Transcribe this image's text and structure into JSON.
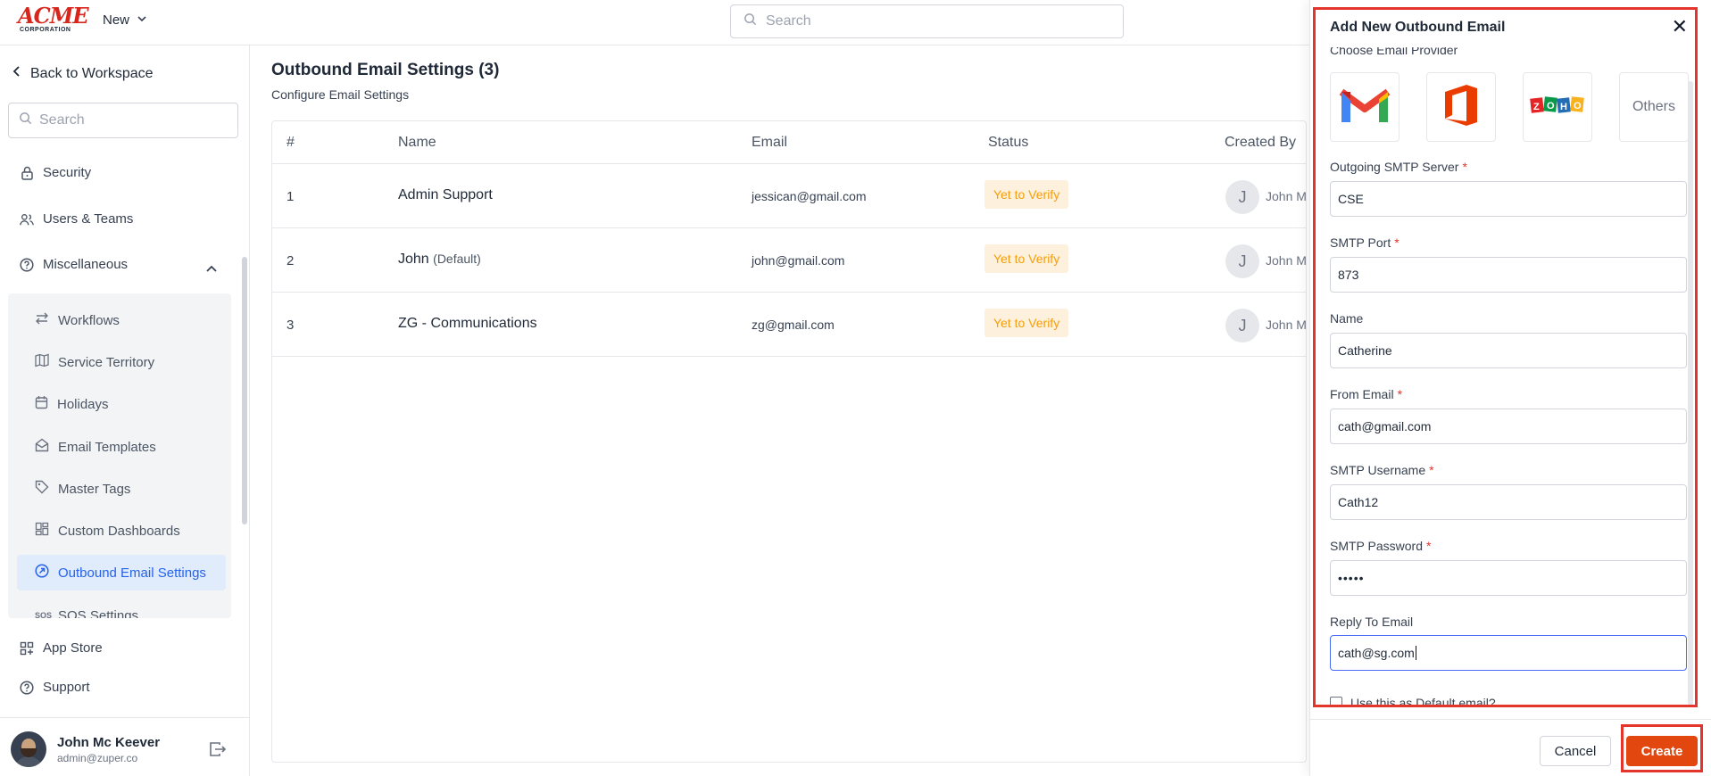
{
  "topbar": {
    "logo_main": "ACME",
    "logo_sub": "CORPORATION",
    "new_label": "New",
    "search_placeholder": "Search"
  },
  "sidebar": {
    "back_label": "Back to Workspace",
    "search_placeholder": "Search",
    "items": [
      {
        "label": "Security",
        "icon": "lock-icon"
      },
      {
        "label": "Users & Teams",
        "icon": "users-icon"
      },
      {
        "label": "Miscellaneous",
        "icon": "help-circle-icon"
      },
      {
        "label": "App Store",
        "icon": "grid-icon"
      },
      {
        "label": "Support",
        "icon": "help-circle-icon"
      }
    ],
    "sub_items": [
      {
        "label": "Workflows",
        "icon": "workflow-icon"
      },
      {
        "label": "Service Territory",
        "icon": "map-icon"
      },
      {
        "label": "Holidays",
        "icon": "calendar-icon"
      },
      {
        "label": "Email Templates",
        "icon": "mail-open-icon"
      },
      {
        "label": "Master Tags",
        "icon": "tag-icon"
      },
      {
        "label": "Custom Dashboards",
        "icon": "dashboard-icon"
      },
      {
        "label": "Outbound Email Settings",
        "icon": "outbound-icon",
        "active": true
      },
      {
        "label": "SOS Settings",
        "icon": "sos-icon"
      }
    ],
    "sos_icon_text": "SOS",
    "user": {
      "name": "John Mc Keever",
      "email": "admin@zuper.co"
    }
  },
  "main": {
    "title": "Outbound Email Settings (3)",
    "subtitle": "Configure Email Settings",
    "columns": [
      "#",
      "Name",
      "Email",
      "Status",
      "Created By"
    ],
    "rows": [
      {
        "num": "1",
        "name": "Admin Support",
        "default": "",
        "email": "jessican@gmail.com",
        "status": "Yet to Verify",
        "initial": "J",
        "created_by": "John Mc Keever"
      },
      {
        "num": "2",
        "name": "John",
        "default": "(Default)",
        "email": "john@gmail.com",
        "status": "Yet to Verify",
        "initial": "J",
        "created_by": "John Mc Keever"
      },
      {
        "num": "3",
        "name": "ZG - Communications",
        "default": "",
        "email": "zg@gmail.com",
        "status": "Yet to Verify",
        "initial": "J",
        "created_by": "John Mc Keever"
      }
    ]
  },
  "drawer": {
    "title": "Add New Outbound Email",
    "provider_label": "Choose Email Provider",
    "providers": [
      {
        "name": "gmail",
        "icon": "gmail-icon"
      },
      {
        "name": "office",
        "icon": "office-icon"
      },
      {
        "name": "zoho",
        "icon": "zoho-icon",
        "text": "ZOHO"
      },
      {
        "name": "others",
        "text": "Others"
      }
    ],
    "fields": {
      "smtp_server": {
        "label": "Outgoing SMTP Server",
        "value": "CSE"
      },
      "smtp_port": {
        "label": "SMTP Port",
        "value": "873"
      },
      "name": {
        "label": "Name",
        "value": "Catherine"
      },
      "from_email": {
        "label": "From Email",
        "value": "cath@gmail.com"
      },
      "smtp_username": {
        "label": "SMTP Username",
        "value": "Cath12"
      },
      "smtp_password": {
        "label": "SMTP Password",
        "value": "•••••"
      },
      "reply_to": {
        "label": "Reply To Email",
        "value": "cath@sg.com"
      }
    },
    "default_checkbox_label": "Use this as Default email?",
    "cancel_label": "Cancel",
    "create_label": "Create"
  },
  "colors": {
    "accent_blue": "#2563eb",
    "highlight_red": "#e3352b",
    "create_orange": "#e2470f",
    "badge_bg": "#fdf0dc",
    "badge_text": "#f59e0b"
  }
}
